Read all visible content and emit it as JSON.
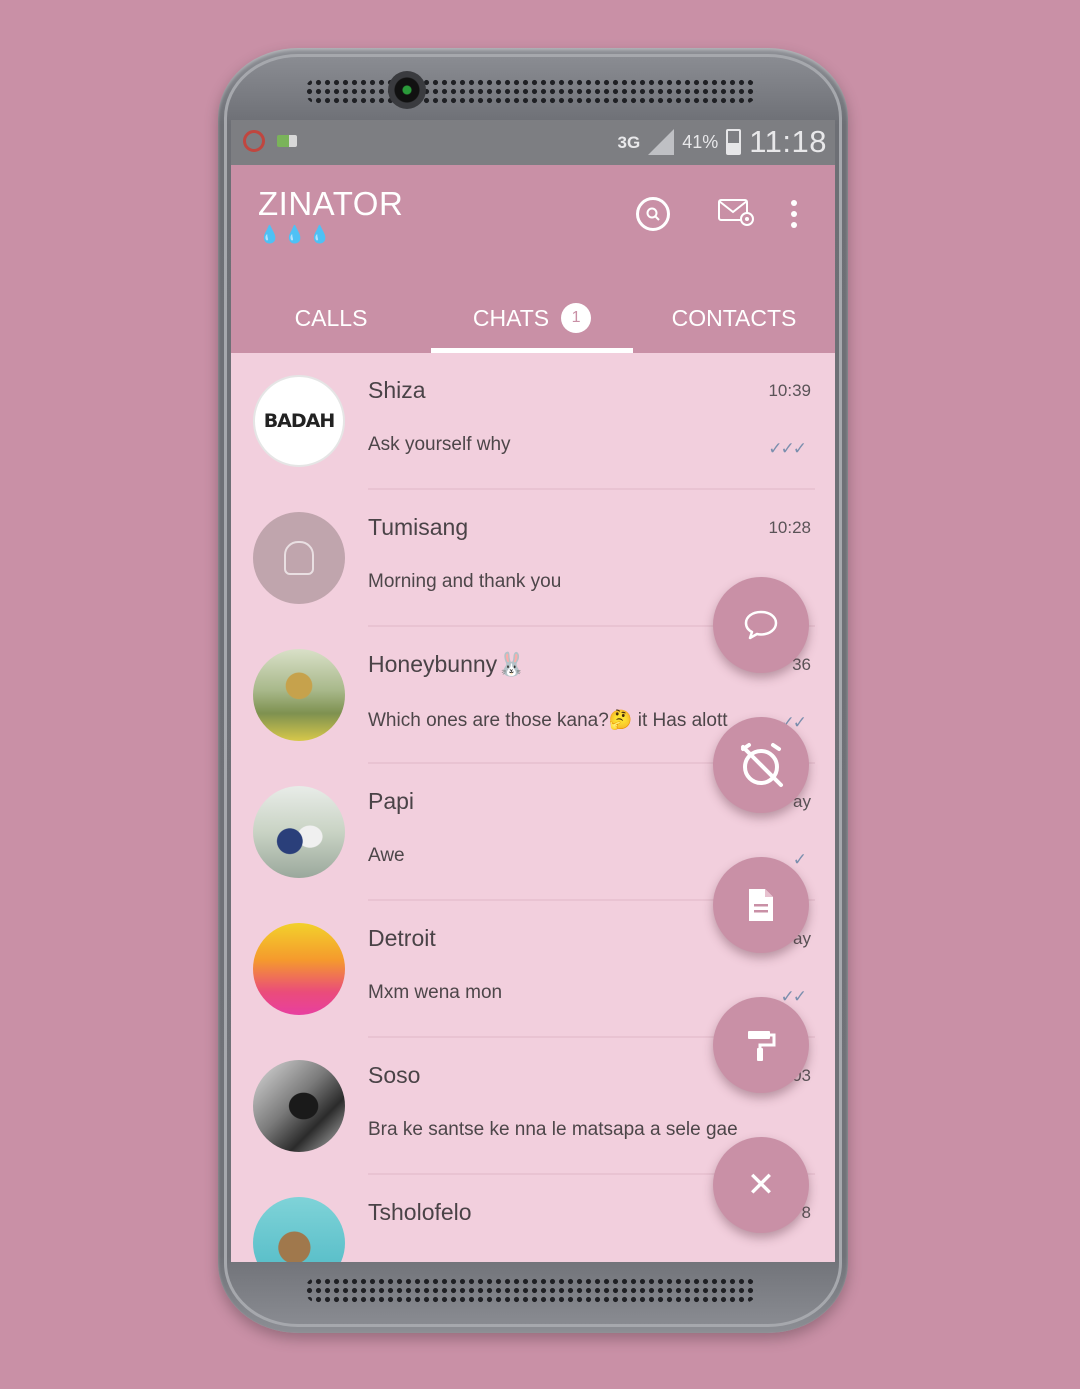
{
  "status_bar": {
    "network": "3G",
    "battery_percent": "41%",
    "time": "11:18"
  },
  "app_bar": {
    "title": "ZINATOR",
    "subtitle_icons": "💧💧💧",
    "icons": [
      "search-icon",
      "mail-settings-icon",
      "more-vert-icon"
    ]
  },
  "tabs": [
    {
      "label": "CALLS",
      "active": false
    },
    {
      "label": "CHATS",
      "badge": "1",
      "active": true
    },
    {
      "label": "CONTACTS",
      "active": false
    }
  ],
  "chats": [
    {
      "name": "Shiza",
      "message": "Ask yourself why",
      "time": "10:39",
      "ticks": "✓✓✓",
      "avatar_text": "BADAH"
    },
    {
      "name": "Tumisang",
      "message": "Morning and thank you",
      "time": "10:28",
      "ticks": ""
    },
    {
      "name": "Honeybunny🐰",
      "message": "Which ones are those kana?🤔 it Has alott",
      "time": "36",
      "ticks": "✓✓"
    },
    {
      "name": "Papi",
      "message": "Awe",
      "time": "ay",
      "ticks": "✓"
    },
    {
      "name": "Detroit",
      "message": "Mxm wena mon",
      "time": "ay",
      "ticks": "✓✓"
    },
    {
      "name": "Soso",
      "message": "Bra ke santse ke nna le matsapa a sele gae",
      "time": "03",
      "ticks": ""
    },
    {
      "name": "Tsholofelo",
      "message": "",
      "time": "8",
      "ticks": ""
    }
  ],
  "fabs": [
    "new-chat-icon",
    "alarm-off-icon",
    "document-icon",
    "paint-roller-icon",
    "close-icon"
  ],
  "fab_close_glyph": "✕",
  "colors": {
    "background": "#c990a6",
    "app_bar": "#c990a6",
    "list_background": "#f2cfdd",
    "status_bar": "#7d7e82",
    "text": "#4a4347"
  }
}
